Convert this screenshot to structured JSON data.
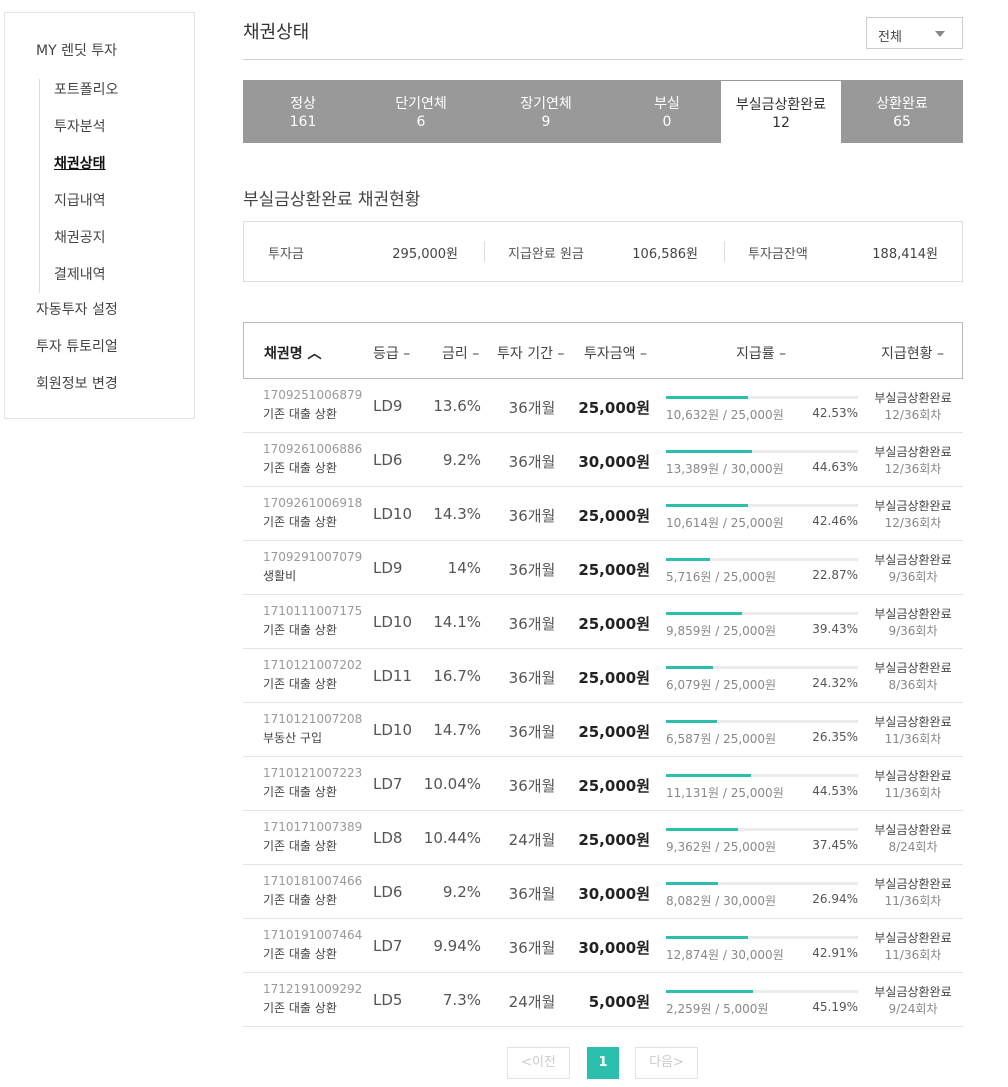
{
  "sidebar": {
    "top_items": [
      "MY 렌딧 투자",
      "자동투자 설정",
      "투자 튜토리얼",
      "회원정보 변경"
    ],
    "sub_items": [
      "포트폴리오",
      "투자분석",
      "채권상태",
      "지급내역",
      "채권공지",
      "결제내역"
    ],
    "active_sub": "채권상태"
  },
  "page": {
    "title": "채권상태",
    "filter_value": "전체"
  },
  "tabs": [
    {
      "label": "정상",
      "count": "161"
    },
    {
      "label": "단기연체",
      "count": "6"
    },
    {
      "label": "장기연체",
      "count": "9"
    },
    {
      "label": "부실",
      "count": "0"
    },
    {
      "label": "부실금상환완료",
      "count": "12"
    },
    {
      "label": "상환완료",
      "count": "65"
    }
  ],
  "active_tab": "부실금상환완료",
  "section_title": "부실금상환완료 채권현황",
  "summary": {
    "invest_label": "투자금",
    "invest_value": "295,000원",
    "paid_label": "지급완료 원금",
    "paid_value": "106,586원",
    "remain_label": "투자금잔액",
    "remain_value": "188,414원"
  },
  "table": {
    "headers": {
      "name": "채권명 ︿",
      "grade": "등급 –",
      "rate": "금리 –",
      "term": "투자 기간 –",
      "amount": "투자금액 –",
      "ratio": "지급률 –",
      "status": "지급현황 –"
    },
    "rows": [
      {
        "id": "1709251006879",
        "purpose": "기존 대출 상환",
        "grade": "LD9",
        "rate": "13.6%",
        "term": "36개월",
        "amount": "25,000원",
        "paid": "10,632원 / 25,000원",
        "pct": "42.53%",
        "ratio": 42.53,
        "status": "부실금상환완료",
        "inst": "12/36회차"
      },
      {
        "id": "1709261006886",
        "purpose": "기존 대출 상환",
        "grade": "LD6",
        "rate": "9.2%",
        "term": "36개월",
        "amount": "30,000원",
        "paid": "13,389원 / 30,000원",
        "pct": "44.63%",
        "ratio": 44.63,
        "status": "부실금상환완료",
        "inst": "12/36회차"
      },
      {
        "id": "1709261006918",
        "purpose": "기존 대출 상환",
        "grade": "LD10",
        "rate": "14.3%",
        "term": "36개월",
        "amount": "25,000원",
        "paid": "10,614원 / 25,000원",
        "pct": "42.46%",
        "ratio": 42.46,
        "status": "부실금상환완료",
        "inst": "12/36회차"
      },
      {
        "id": "1709291007079",
        "purpose": "생활비",
        "grade": "LD9",
        "rate": "14%",
        "term": "36개월",
        "amount": "25,000원",
        "paid": "5,716원 / 25,000원",
        "pct": "22.87%",
        "ratio": 22.87,
        "status": "부실금상환완료",
        "inst": "9/36회차"
      },
      {
        "id": "1710111007175",
        "purpose": "기존 대출 상환",
        "grade": "LD10",
        "rate": "14.1%",
        "term": "36개월",
        "amount": "25,000원",
        "paid": "9,859원 / 25,000원",
        "pct": "39.43%",
        "ratio": 39.43,
        "status": "부실금상환완료",
        "inst": "9/36회차"
      },
      {
        "id": "1710121007202",
        "purpose": "기존 대출 상환",
        "grade": "LD11",
        "rate": "16.7%",
        "term": "36개월",
        "amount": "25,000원",
        "paid": "6,079원 / 25,000원",
        "pct": "24.32%",
        "ratio": 24.32,
        "status": "부실금상환완료",
        "inst": "8/36회차"
      },
      {
        "id": "1710121007208",
        "purpose": "부동산 구입",
        "grade": "LD10",
        "rate": "14.7%",
        "term": "36개월",
        "amount": "25,000원",
        "paid": "6,587원 / 25,000원",
        "pct": "26.35%",
        "ratio": 26.35,
        "status": "부실금상환완료",
        "inst": "11/36회차"
      },
      {
        "id": "1710121007223",
        "purpose": "기존 대출 상환",
        "grade": "LD7",
        "rate": "10.04%",
        "term": "36개월",
        "amount": "25,000원",
        "paid": "11,131원 / 25,000원",
        "pct": "44.53%",
        "ratio": 44.53,
        "status": "부실금상환완료",
        "inst": "11/36회차"
      },
      {
        "id": "1710171007389",
        "purpose": "기존 대출 상환",
        "grade": "LD8",
        "rate": "10.44%",
        "term": "24개월",
        "amount": "25,000원",
        "paid": "9,362원 / 25,000원",
        "pct": "37.45%",
        "ratio": 37.45,
        "status": "부실금상환완료",
        "inst": "8/24회차"
      },
      {
        "id": "1710181007466",
        "purpose": "기존 대출 상환",
        "grade": "LD6",
        "rate": "9.2%",
        "term": "36개월",
        "amount": "30,000원",
        "paid": "8,082원 / 30,000원",
        "pct": "26.94%",
        "ratio": 26.94,
        "status": "부실금상환완료",
        "inst": "11/36회차"
      },
      {
        "id": "1710191007464",
        "purpose": "기존 대출 상환",
        "grade": "LD7",
        "rate": "9.94%",
        "term": "36개월",
        "amount": "30,000원",
        "paid": "12,874원 / 30,000원",
        "pct": "42.91%",
        "ratio": 42.91,
        "status": "부실금상환완료",
        "inst": "11/36회차"
      },
      {
        "id": "1712191009292",
        "purpose": "기존 대출 상환",
        "grade": "LD5",
        "rate": "7.3%",
        "term": "24개월",
        "amount": "5,000원",
        "paid": "2,259원 / 5,000원",
        "pct": "45.19%",
        "ratio": 45.19,
        "status": "부실금상환완료",
        "inst": "9/24회차"
      }
    ]
  },
  "pagination": {
    "prev": "<이전",
    "current": "1",
    "next": "다음>"
  },
  "colors": {
    "accent": "#2bbfae",
    "tab_bg": "#999999"
  }
}
